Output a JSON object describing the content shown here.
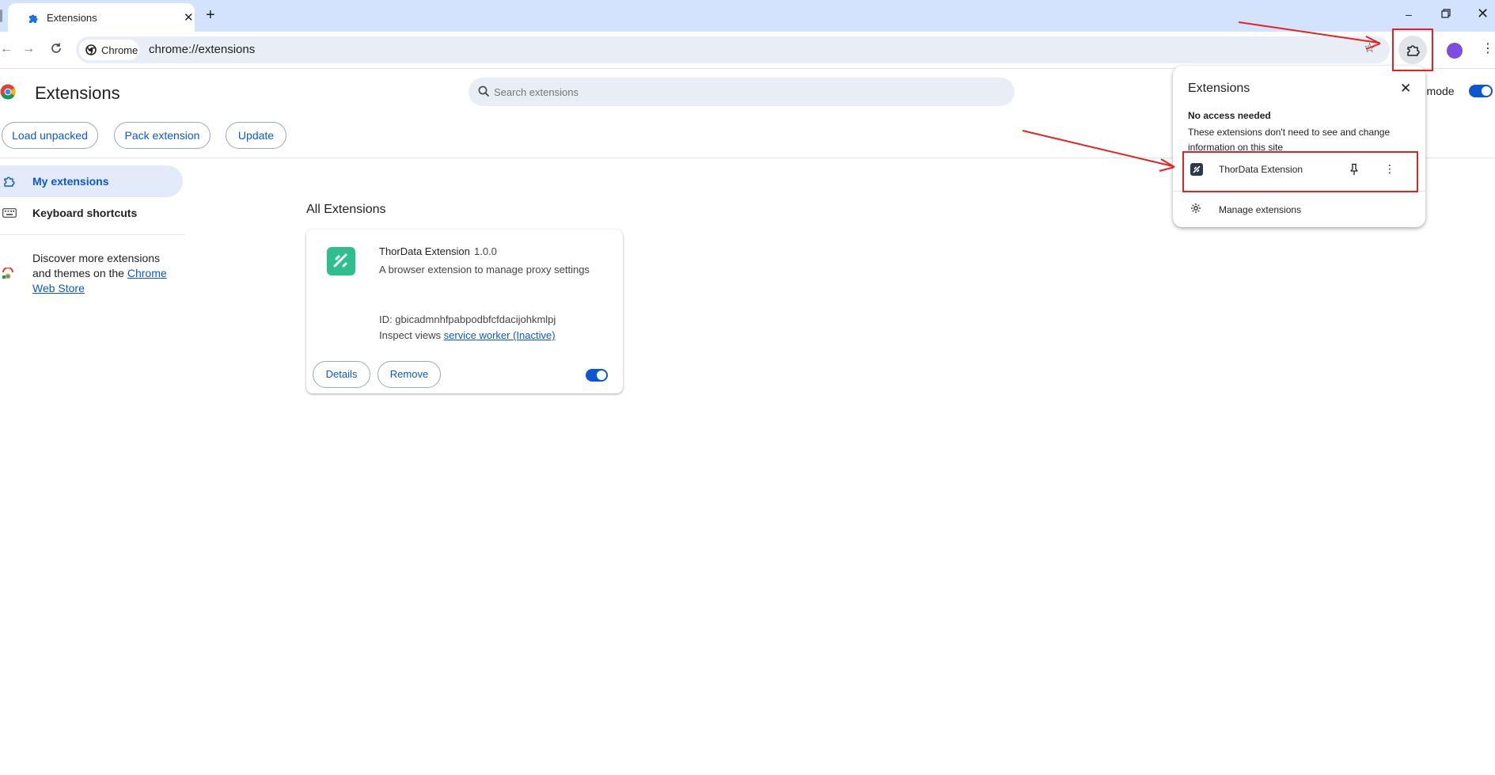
{
  "browser": {
    "tab_title": "Extensions",
    "tab_close": "✕",
    "new_tab": "+",
    "window_min": "–",
    "window_close": "✕",
    "omnibox_chip": "Chrome",
    "url": "chrome://extensions",
    "menu_dots": "⋮"
  },
  "header": {
    "title": "Extensions",
    "search_placeholder": "Search extensions",
    "dev_mode_label": "r mode",
    "dev_mode_on": true
  },
  "toolbar_buttons": {
    "load_unpacked": "Load unpacked",
    "pack_extension": "Pack extension",
    "update": "Update"
  },
  "sidebar": {
    "my_extensions": "My extensions",
    "keyboard_shortcuts": "Keyboard shortcuts",
    "store_text_prefix": "Discover more extensions and themes on the ",
    "store_link": "Chrome Web Store"
  },
  "main": {
    "section_title": "All Extensions",
    "extension": {
      "name": "ThorData Extension",
      "version": "1.0.0",
      "description": "A browser extension to manage proxy settings",
      "id_label": "ID: gbicadmnhfpabpodbfcfdacijohkmlpj",
      "inspect_prefix": "Inspect views ",
      "service_worker": "service worker (Inactive)",
      "details": "Details",
      "remove": "Remove",
      "enabled": true
    }
  },
  "popup": {
    "title": "Extensions",
    "close": "✕",
    "section_heading": "No access needed",
    "section_desc": "These extensions don't need to see and change information on this site",
    "item_name": "ThorData Extension",
    "item_more": "⋮",
    "manage": "Manage extensions"
  },
  "colors": {
    "accent": "#0b57d0",
    "tabstrip": "#d3e3fd",
    "annotation": "#e52222",
    "extension_icon": "#2fbf8e"
  }
}
